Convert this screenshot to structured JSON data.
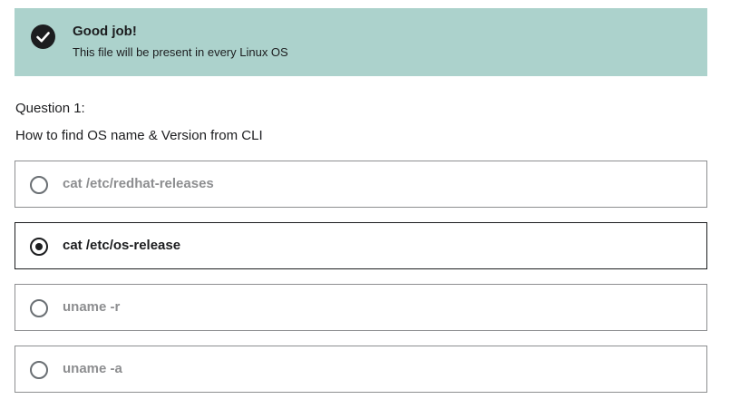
{
  "alert": {
    "icon": "check-circle-icon",
    "title": "Good job!",
    "message": "This file will be present in every Linux OS",
    "background": "#acd2cc"
  },
  "question": {
    "label": "Question 1:",
    "prompt": "How to find OS name & Version from CLI"
  },
  "options": [
    {
      "label": "cat /etc/redhat-releases",
      "selected": false
    },
    {
      "label": "cat /etc/os-release",
      "selected": true
    },
    {
      "label": "uname -r",
      "selected": false
    },
    {
      "label": "uname -a",
      "selected": false
    }
  ]
}
